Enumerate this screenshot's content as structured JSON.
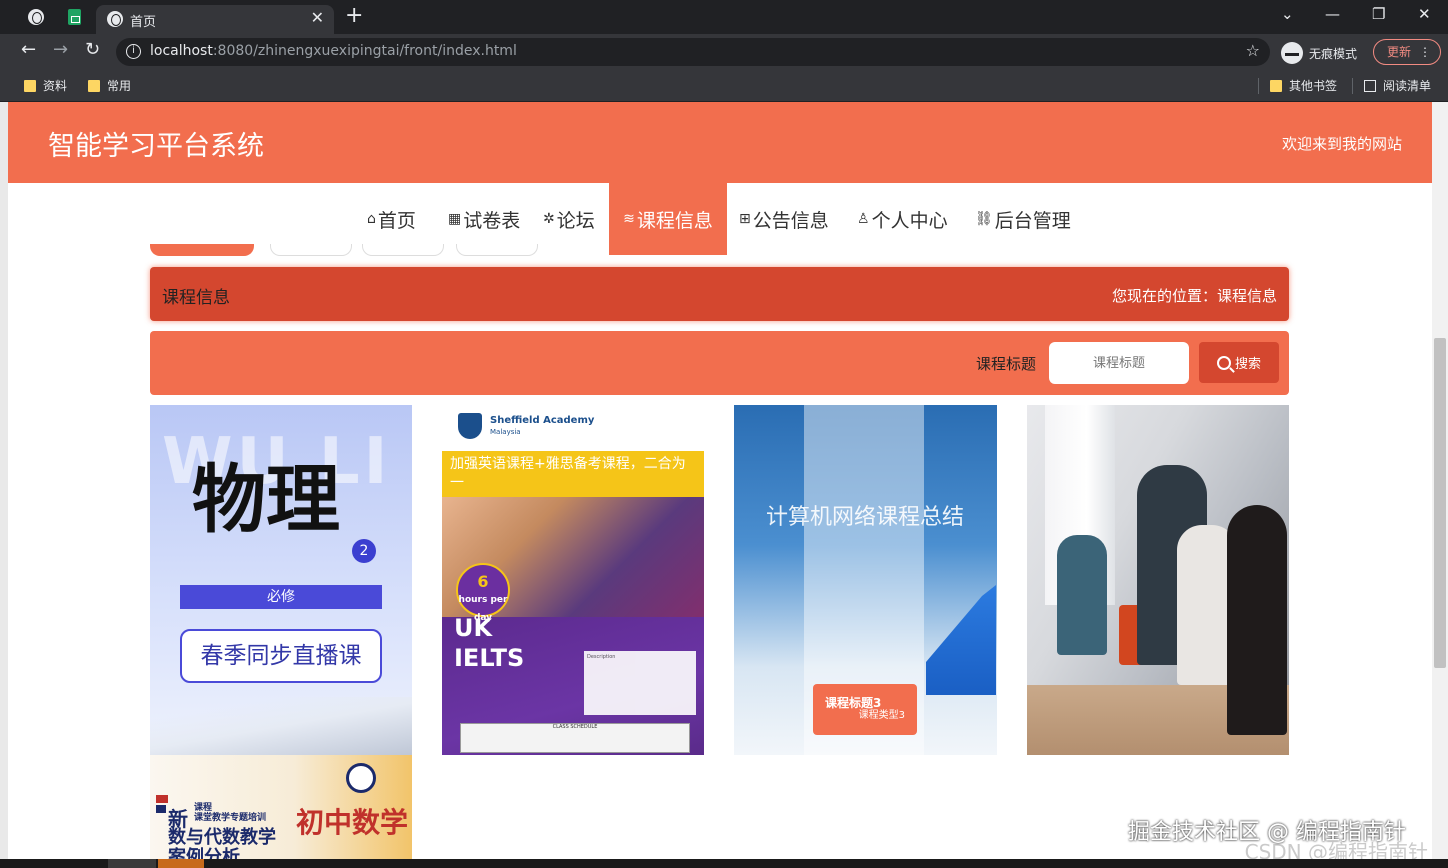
{
  "browser": {
    "tab_title": "首页",
    "tab_close": "✕",
    "new_tab": "+",
    "window": {
      "minimize": "—",
      "restore": "❐",
      "close": "✕",
      "tab_search": "⌄"
    },
    "nav": {
      "back": "←",
      "forward": "→",
      "reload": "↻"
    },
    "url_host": "localhost",
    "url_rest": ":8080/zhinengxuexipingtai/front/index.html",
    "star": "☆",
    "incognito_label": "无痕模式",
    "update_label": "更新",
    "update_menu": "⋮",
    "bookmarks": [
      {
        "label": "资料"
      },
      {
        "label": "常用"
      }
    ],
    "bookmarks_right": {
      "other": "其他书签",
      "reading_list": "阅读清单"
    }
  },
  "site": {
    "title": "智能学习平台系统",
    "welcome": "欢迎来到我的网站"
  },
  "nav": [
    {
      "icon": "⌂",
      "icon_name": "home-icon",
      "label": "首页"
    },
    {
      "icon": "▦",
      "icon_name": "grid-icon",
      "label": "试卷表"
    },
    {
      "icon": "✲",
      "icon_name": "spark-icon",
      "label": "论坛"
    },
    {
      "icon": "≋",
      "icon_name": "layers-icon",
      "label": "课程信息",
      "active": true
    },
    {
      "icon": "⊞",
      "icon_name": "gift-icon",
      "label": "公告信息"
    },
    {
      "icon": "♙",
      "icon_name": "user-icon",
      "label": "个人中心"
    },
    {
      "icon": "⛓",
      "icon_name": "link-icon",
      "label": "后台管理"
    }
  ],
  "breadcrumb": {
    "title": "课程信息",
    "location": "您现在的位置：课程信息"
  },
  "search": {
    "label": "课程标题",
    "placeholder": "课程标题",
    "button": "搜索"
  },
  "cards": [
    {
      "watermark": "WU LI",
      "big": "物理",
      "num": "2",
      "tag": "必修",
      "pill": "春季同步直播课"
    },
    {
      "brand": "Sheffield Academy",
      "brand_sub": "Malaysia",
      "banner": "加强英语课程+雅思备考课程，二合为一",
      "hours": "6",
      "hours_unit": "hours per day",
      "uk": "UK",
      "ielts": "IELTS",
      "desc_title": "Description",
      "sched_title": "CLASS SCHEDULE"
    },
    {
      "title": "计算机网络课程总结",
      "label_title": "课程标题3",
      "label_sub": "课程类型3"
    },
    {},
    {
      "new": "新",
      "new_small": "课程\n课堂教学专题培训",
      "line1": "数与代数教学",
      "line2": "案例分析",
      "math": "初中数学"
    }
  ],
  "watermarks": {
    "juejin": "掘金技术社区 @ 编程指南针",
    "csdn": "CSDN @编程指南针"
  },
  "colors": {
    "brand": "#f26e4e",
    "brand_dark": "#d4472f"
  }
}
